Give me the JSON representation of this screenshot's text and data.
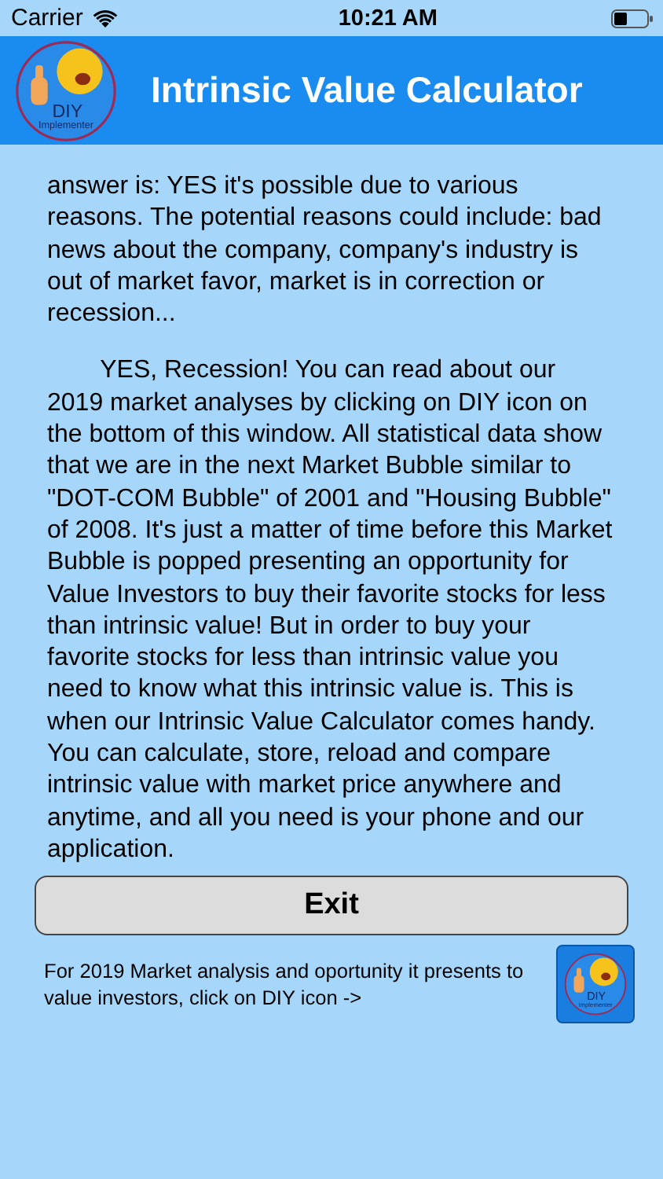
{
  "status_bar": {
    "carrier": "Carrier",
    "time": "10:21 AM"
  },
  "header": {
    "logo": {
      "line1": "DIY",
      "line2": "Implementer"
    },
    "title": "Intrinsic Value Calculator"
  },
  "paragraphs": [
    {
      "text": "answer is: YES it's possible due to various reasons. The potential reasons could include: bad news about the company, company's industry is out of market favor, market is in correction or recession...",
      "indented": false
    },
    {
      "text": "YES, Recession! You can read about our 2019 market analyses by clicking on DIY icon on the bottom of this window. All statistical data show that we are in the next Market Bubble similar to \"DOT-COM Bubble\" of 2001 and \"Housing Bubble\" of 2008. It's just a matter of time before this Market Bubble is popped presenting an opportunity for Value Investors to buy their favorite stocks for less than intrinsic value! But in order to buy your favorite stocks for less than intrinsic value you need to know what this intrinsic value is.  This is when our Intrinsic Value Calculator comes handy. You can calculate, store, reload and compare intrinsic value with market price anywhere and anytime, and all you need is your phone and our application.",
      "indented": true
    }
  ],
  "exit_button": "Exit",
  "footer": {
    "text": "For 2019 Market analysis and oportunity it presents to value investors, click on DIY icon ->",
    "icon": {
      "line1": "DIY",
      "line2": "Implementer"
    }
  }
}
